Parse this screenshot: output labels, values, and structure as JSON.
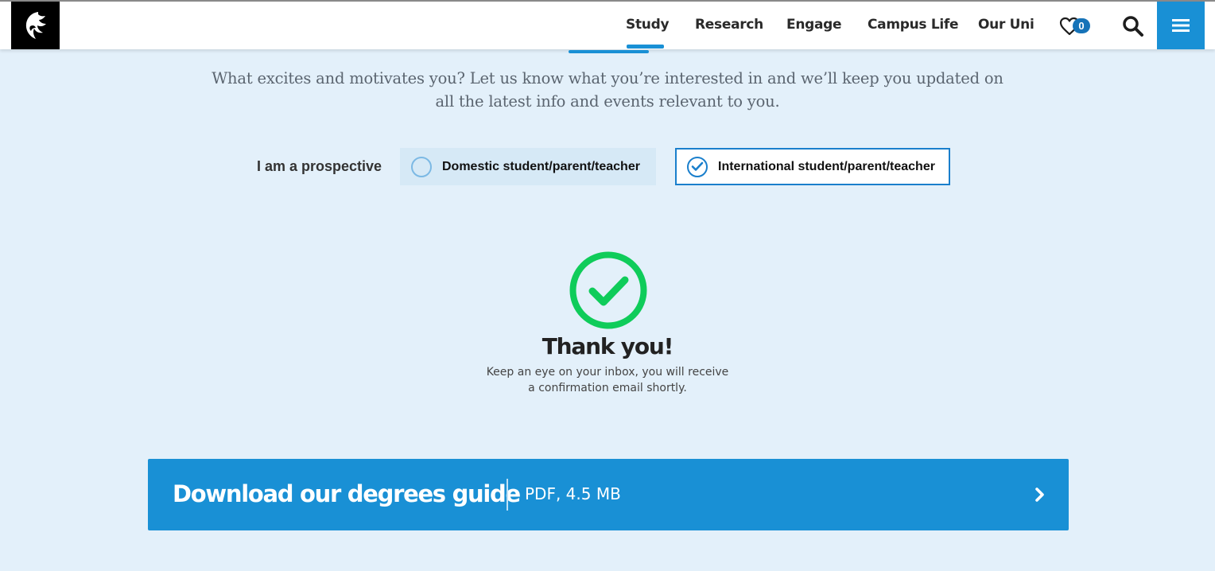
{
  "nav": {
    "items": [
      {
        "label": "Study"
      },
      {
        "label": "Research"
      },
      {
        "label": "Engage"
      },
      {
        "label": "Campus Life"
      },
      {
        "label": "Our Uni"
      }
    ],
    "active": "Study",
    "favourites_count": "0",
    "icons": {
      "logo": "university-crest-logo",
      "favourites": "heart-icon",
      "search": "search-icon",
      "menu": "hamburger-menu-icon"
    },
    "accent_color": "#1990d5"
  },
  "intro": {
    "text": "What excites and motivates you? Let us know what you’re interested in and we’ll keep you updated on all the latest info and events relevant to you."
  },
  "prospective": {
    "label": "I am a prospective",
    "options": [
      {
        "label": "Domestic student/parent/teacher",
        "selected": false
      },
      {
        "label": "International student/parent/teacher",
        "selected": true
      }
    ]
  },
  "confirmation": {
    "icon": "check-circle-icon",
    "icon_color": "#0fcc5a",
    "title": "Thank you!",
    "message_line1": "Keep an eye on your inbox, you will receive",
    "message_line2": "a confirmation email shortly."
  },
  "download": {
    "title": "Download our degrees guide",
    "meta": "PDF, 4.5 MB",
    "icon": "chevron-right-icon",
    "background_color": "#1990d5"
  }
}
